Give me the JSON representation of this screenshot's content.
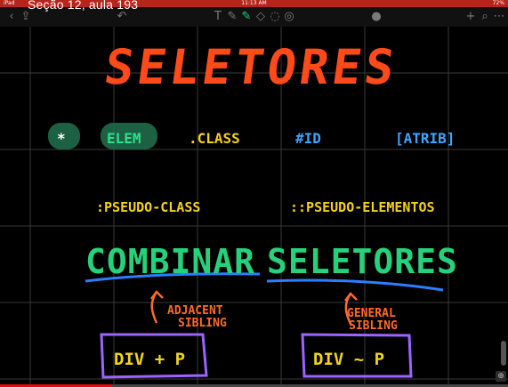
{
  "status": {
    "left": "iPad",
    "time": "11:13 AM",
    "battery": "72%"
  },
  "video_title": "Seção 12, aula 193",
  "toolbar": {
    "icons": [
      "chevron-left-icon",
      "share-icon",
      "undo-icon",
      "text-icon",
      "pen-icon",
      "highlighter-icon",
      "eraser-icon",
      "shapes-icon",
      "lasso-icon",
      "mic-icon",
      "add-icon",
      "lock-icon",
      "more-icon"
    ]
  },
  "board": {
    "title": "SELETORES",
    "selectors": {
      "universal": "*",
      "element": "ELEM",
      "class": ".CLASS",
      "id": "#ID",
      "attrib": "[ATRIB]"
    },
    "pseudo_class": ":PSEUDO-CLASS",
    "pseudo_elements": "::PSEUDO-ELEMENTOS",
    "combinar_1": "COMBINAR",
    "combinar_2": "SELETORES",
    "adjacent_label_1": "ADJACENT",
    "adjacent_label_2": "SIBLING",
    "general_label_1": "GENERAL",
    "general_label_2": "SIBLING",
    "adjacent_code": "DIV + P",
    "general_code": "DIV ~ P"
  },
  "colors": {
    "title": "#ff4a1a",
    "selector": "#f4d21b",
    "blue": "#3ba6ff",
    "green": "#27d07a",
    "purple": "#9d63ff",
    "orange": "#ff6a2a"
  },
  "progress": 0.22
}
